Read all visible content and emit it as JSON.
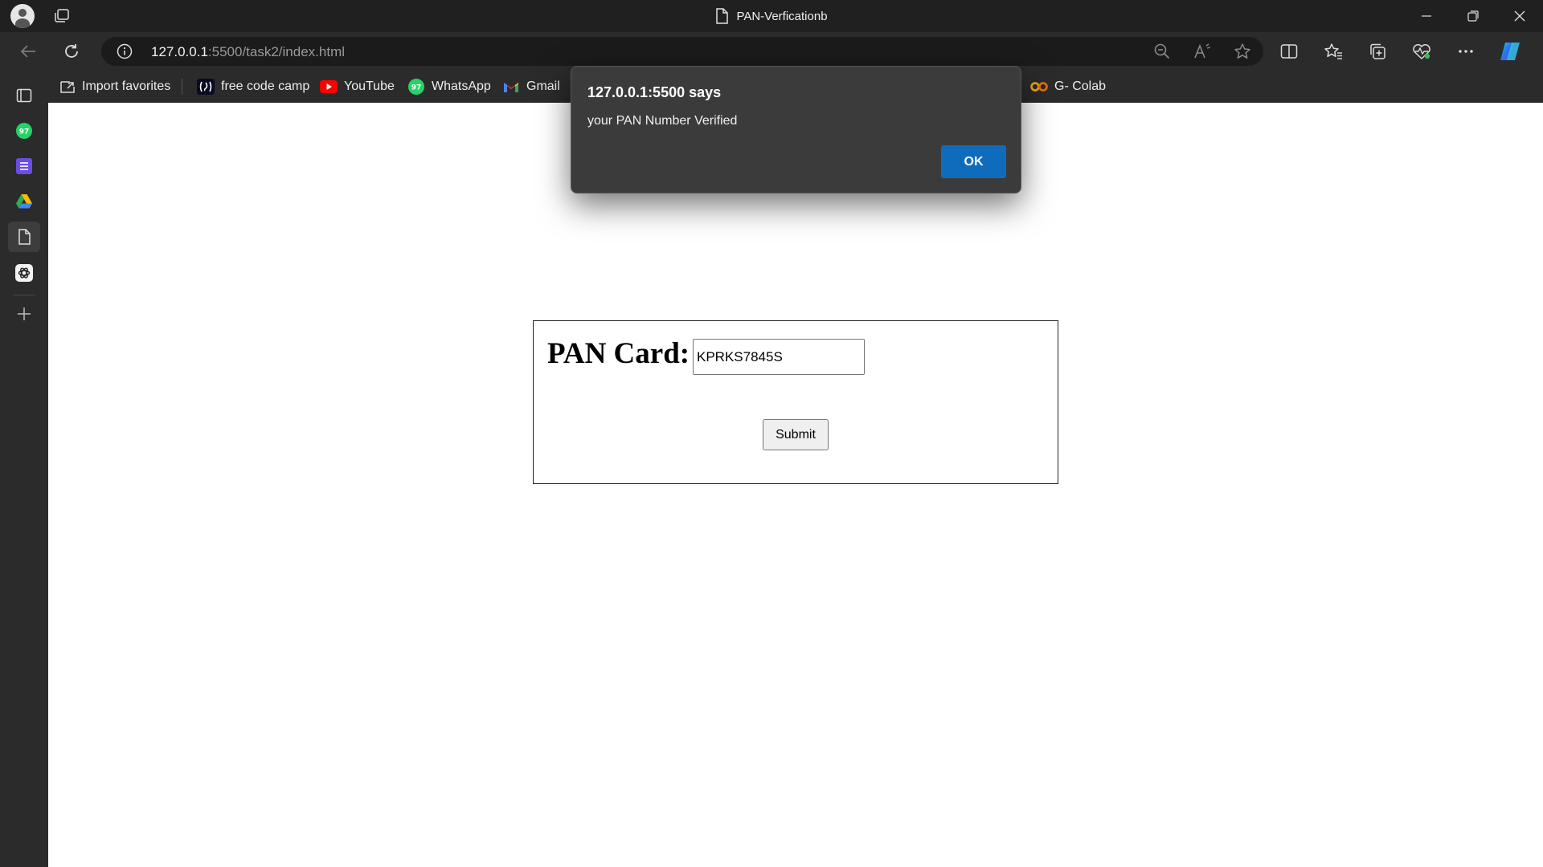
{
  "window": {
    "tab_title": "PAN-Verficationb",
    "icons": {
      "profile": "profile-icon",
      "workspaces": "workspaces-icon",
      "page": "page-icon",
      "minimize": "minimize-icon",
      "restore": "restore-icon",
      "close": "close-icon"
    }
  },
  "toolbar": {
    "url_host": "127.0.0.1",
    "url_rest": ":5500/task2/index.html",
    "icons": [
      "back-icon",
      "refresh-icon",
      "site-info-icon",
      "zoom-out-icon",
      "read-aloud-icon",
      "add-favorite-icon",
      "split-screen-icon",
      "favorites-icon",
      "collections-icon",
      "browser-essentials-icon",
      "more-icon",
      "copilot-icon"
    ]
  },
  "favorites": [
    {
      "label": "Import favorites",
      "icon": "import-icon"
    },
    {
      "label": "free code camp",
      "icon": "freecodecamp-icon"
    },
    {
      "label": "YouTube",
      "icon": "youtube-icon"
    },
    {
      "label": "WhatsApp",
      "icon": "whatsapp-icon"
    },
    {
      "label": "Gmail",
      "icon": "gmail-icon"
    },
    {
      "label": "G- Colab",
      "icon": "colab-icon"
    }
  ],
  "sidebar": {
    "whatsapp_badge": "97",
    "icons": [
      "tab-actions-icon",
      "whatsapp-icon",
      "list-icon",
      "drive-icon",
      "page-icon",
      "chatgpt-icon",
      "add-icon"
    ]
  },
  "page": {
    "pan_label": "PAN Card:",
    "pan_value": "KPRKS7845S",
    "submit_label": "Submit"
  },
  "dialog": {
    "title": "127.0.0.1:5500 says",
    "message": "your PAN Number Verified",
    "ok_label": "OK"
  },
  "colors": {
    "accent": "#0f6cbd",
    "chrome_bg": "#202020",
    "toolbar_bg": "#2b2b2b",
    "page_bg": "#ffffff"
  }
}
